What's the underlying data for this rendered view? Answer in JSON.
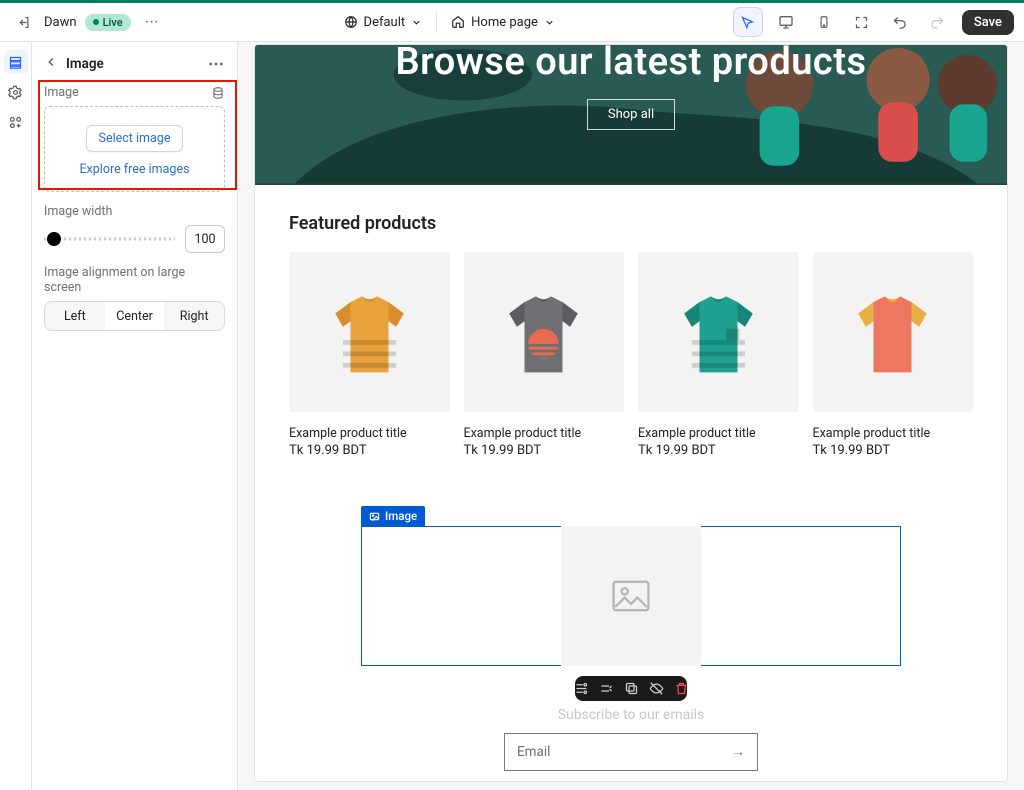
{
  "topbar": {
    "theme_name": "Dawn",
    "live_label": "Live",
    "style_label": "Default",
    "page_label": "Home page",
    "save_label": "Save"
  },
  "panel": {
    "title": "Image",
    "image": {
      "header": "Image",
      "select_btn": "Select image",
      "explore_link": "Explore free images"
    },
    "width": {
      "label": "Image width",
      "value": "100"
    },
    "align": {
      "label": "Image alignment on large screen",
      "options": [
        "Left",
        "Center",
        "Right"
      ],
      "selected_index": 1
    }
  },
  "preview": {
    "hero_title": "Browse our latest products",
    "hero_cta": "Shop all",
    "featured_heading": "Featured products",
    "products": [
      {
        "title": "Example product title",
        "price": "Tk 19.99 BDT",
        "color_body": "#e9a13b",
        "color_sleeve": "#d78f2d",
        "stripes": true,
        "sun": false,
        "pocket": false
      },
      {
        "title": "Example product title",
        "price": "Tk 19.99 BDT",
        "color_body": "#6e7073",
        "color_sleeve": "#5b5d60",
        "stripes": false,
        "sun": true,
        "pocket": false
      },
      {
        "title": "Example product title",
        "price": "Tk 19.99 BDT",
        "color_body": "#1fa091",
        "color_sleeve": "#178577",
        "stripes": true,
        "sun": false,
        "pocket": true
      },
      {
        "title": "Example product title",
        "price": "Tk 19.99 BDT",
        "color_body": "#ee7762",
        "color_sleeve": "#e8b042",
        "stripes": false,
        "sun": false,
        "pocket": false
      }
    ],
    "image_block_label": "Image",
    "subscribe_heading": "Subscribe to our emails",
    "email_placeholder": "Email"
  }
}
